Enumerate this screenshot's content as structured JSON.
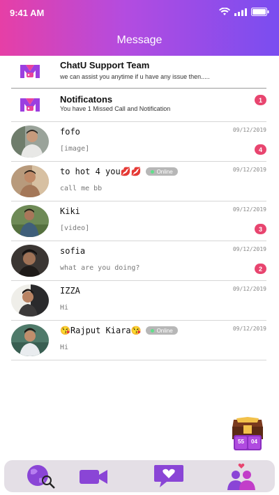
{
  "status_bar": {
    "time": "9:41 AM"
  },
  "header": {
    "title": "Message"
  },
  "system_items": [
    {
      "title": "ChatU Support Team",
      "subtitle": "we can assist you anytime if u have any issue then....."
    },
    {
      "title": "Notificatons",
      "subtitle": "You have 1 Missed Call and Notification",
      "badge": "1"
    }
  ],
  "chats": [
    {
      "name": "fofo",
      "preview": "[image]",
      "date": "09/12/2019",
      "badge": "4"
    },
    {
      "name": "to hot 4 you💋💋",
      "preview": "call me bb",
      "date": "09/12/2019",
      "online": "Online"
    },
    {
      "name": "Kiki",
      "preview": "[video]",
      "date": "09/12/2019",
      "badge": "3"
    },
    {
      "name": "sofia",
      "preview": "what are you doing?",
      "date": "09/12/2019",
      "badge": "2"
    },
    {
      "name": "IZZA",
      "preview": "Hi",
      "date": "09/12/2019"
    },
    {
      "name": "😘Rajput Kiara😘",
      "preview": "Hi",
      "date": "09/12/2019",
      "online": "Online"
    }
  ],
  "treasure": {
    "left_count": "55",
    "right_count": "04"
  },
  "colors": {
    "header_start": "#e63fa6",
    "header_end": "#7a4df0",
    "badge": "#e8456f",
    "nav_bg": "#e4dfe6",
    "accent": "#9b3fe0"
  },
  "nav_icons": [
    "globe-search-icon",
    "video-camera-icon",
    "chat-heart-icon",
    "couple-heart-icon"
  ]
}
